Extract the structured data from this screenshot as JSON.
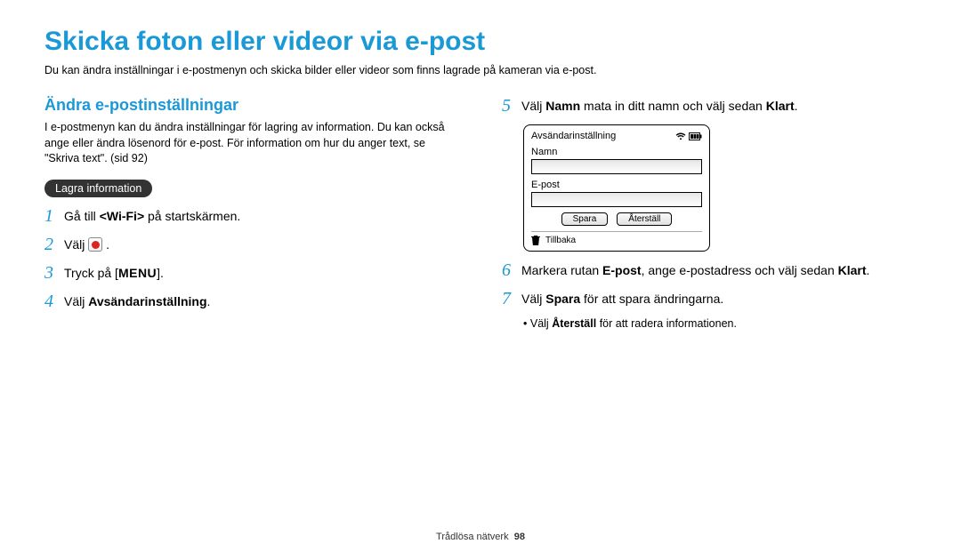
{
  "page": {
    "title": "Skicka foton eller videor via e-post",
    "intro": "Du kan ändra inställningar i e-postmenyn och skicka bilder eller videor som finns lagrade på kameran via e-post."
  },
  "section": {
    "heading": "Ändra e-postinställningar",
    "intro": "I e-postmenyn kan du ändra inställningar för lagring av information. Du kan också ange eller ändra lösenord för e-post. För information om hur du anger text, se \"Skriva text\". (sid 92)",
    "pill": "Lagra information"
  },
  "steps": {
    "s1": {
      "num": "1",
      "pre": "Gå till ",
      "bold": "<Wi-Fi>",
      "post": " på startskärmen."
    },
    "s2": {
      "num": "2",
      "pre": "Välj ",
      "post": "."
    },
    "s3": {
      "num": "3",
      "pre": "Tryck på [",
      "bold": "MENU",
      "post": "]."
    },
    "s4": {
      "num": "4",
      "pre": "Välj ",
      "bold": "Avsändarinställning",
      "post": "."
    },
    "s5": {
      "num": "5",
      "pre": "Välj ",
      "bold1": "Namn",
      "mid": " mata in ditt namn och välj sedan ",
      "bold2": "Klart",
      "post": "."
    },
    "s6": {
      "num": "6",
      "pre": "Markera rutan ",
      "bold1": "E-post",
      "mid": ", ange e-postadress och välj sedan ",
      "bold2": "Klart",
      "post": "."
    },
    "s7": {
      "num": "7",
      "pre": "Välj ",
      "bold1": "Spara",
      "post": " för att spara ändringarna."
    },
    "s7bullet": {
      "pre": "Välj ",
      "bold": "Återställ",
      "post": " för att radera informationen."
    }
  },
  "screenshot": {
    "title": "Avsändarinställning",
    "label1": "Namn",
    "label2": "E-post",
    "btn_save": "Spara",
    "btn_reset": "Återställ",
    "back": "Tillbaka"
  },
  "footer": {
    "section": "Trådlösa nätverk",
    "page": "98"
  }
}
